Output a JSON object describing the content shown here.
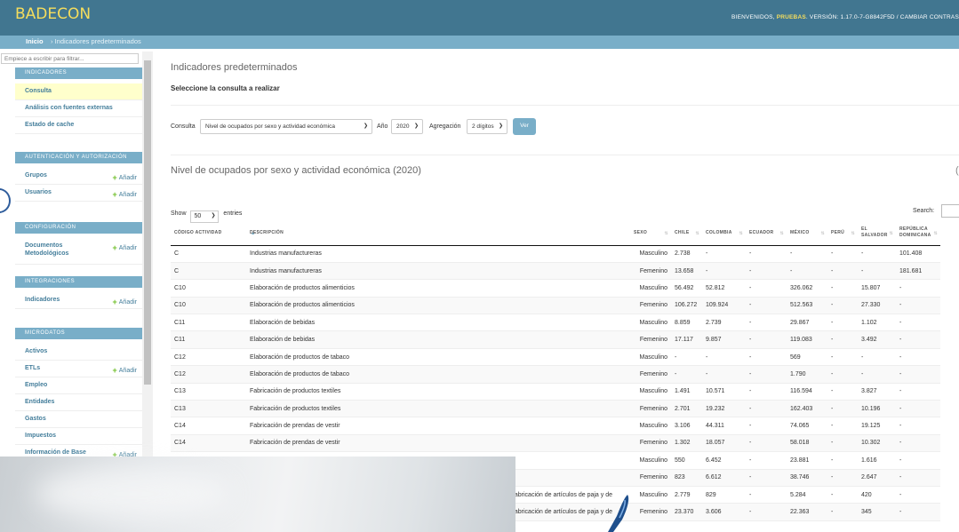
{
  "header": {
    "brand": "BADECON",
    "welcome": "BIENVENIDOS,",
    "user": "PRUEBAS",
    "tools": ". VERSIÓN: 1.17.0-7-G8842F5D / CAMBIAR CONTRAS"
  },
  "breadcrumbs": {
    "home": "Inicio",
    "sep": "›",
    "current": "Indicadores predeterminados"
  },
  "sidebar": {
    "filter_placeholder": "Empiece a escribir para filtrar...",
    "add_label": "Añadir",
    "modules": [
      {
        "header": "INDICADORES",
        "items": [
          {
            "label": "Consulta",
            "add": false,
            "active": true
          },
          {
            "label": "Análisis con fuentes externas",
            "add": false
          },
          {
            "label": "Estado de cache",
            "add": false
          }
        ]
      },
      {
        "header": "AUTENTICACIÓN Y AUTORIZACIÓN",
        "items": [
          {
            "label": "Grupos",
            "add": true
          },
          {
            "label": "Usuarios",
            "add": true
          }
        ]
      },
      {
        "header": "CONFIGURACIÓN",
        "items": [
          {
            "label": "Documentos Metodológicos",
            "add": true
          }
        ]
      },
      {
        "header": "INTEGRACIONES",
        "items": [
          {
            "label": "Indicadores",
            "add": true
          }
        ]
      },
      {
        "header": "MICRODATOS",
        "items": [
          {
            "label": "Activos",
            "add": false
          },
          {
            "label": "ETLs",
            "add": true
          },
          {
            "label": "Empleo",
            "add": false
          },
          {
            "label": "Entidades",
            "add": false
          },
          {
            "label": "Gastos",
            "add": false
          },
          {
            "label": "Impuestos",
            "add": false
          },
          {
            "label": "Información de Base",
            "add": true
          }
        ]
      }
    ]
  },
  "main": {
    "title": "Indicadores predeterminados",
    "subtitle": "Seleccione la consulta a realizar",
    "form": {
      "consulta_label": "Consulta",
      "consulta_value": "Nivel de ocupados por sexo y actividad económica",
      "anio_label": "Año",
      "anio_value": "2020",
      "agregacion_label": "Agregación",
      "agregacion_value": "2 dígitos",
      "submit": "Ver"
    },
    "table_title": "Nivel de ocupados por sexo y actividad económica (2020)",
    "right_fragment": "(",
    "show_label": "Show",
    "show_value": "50",
    "entries_label": "entries",
    "search_label": "Search:"
  },
  "table": {
    "columns": [
      "CÓDIGO ACTIVIDAD",
      "DESCRIPCIÓN",
      "SEXO",
      "CHILE",
      "COLOMBIA",
      "ECUADOR",
      "MÉXICO",
      "PERÚ",
      "EL SALVADOR",
      "REPÚBLICA DOMINICANA"
    ],
    "rows": [
      [
        "C",
        "Industrias manufactureras",
        "Masculino",
        "2.738",
        "-",
        "-",
        "-",
        "-",
        "-",
        "101.408"
      ],
      [
        "C",
        "Industrias manufactureras",
        "Femenino",
        "13.658",
        "-",
        "-",
        "-",
        "-",
        "-",
        "181.681"
      ],
      [
        "C10",
        "Elaboración de productos alimenticios",
        "Masculino",
        "56.492",
        "52.812",
        "-",
        "326.062",
        "-",
        "15.807",
        "-"
      ],
      [
        "C10",
        "Elaboración de productos alimenticios",
        "Femenino",
        "106.272",
        "109.924",
        "-",
        "512.563",
        "-",
        "27.330",
        "-"
      ],
      [
        "C11",
        "Elaboración de bebidas",
        "Masculino",
        "8.859",
        "2.739",
        "-",
        "29.867",
        "-",
        "1.102",
        "-"
      ],
      [
        "C11",
        "Elaboración de bebidas",
        "Femenino",
        "17.117",
        "9.857",
        "-",
        "119.083",
        "-",
        "3.492",
        "-"
      ],
      [
        "C12",
        "Elaboración de productos de tabaco",
        "Masculino",
        "-",
        "-",
        "-",
        "569",
        "-",
        "-",
        "-"
      ],
      [
        "C12",
        "Elaboración de productos de tabaco",
        "Femenino",
        "-",
        "-",
        "-",
        "1.790",
        "-",
        "-",
        "-"
      ],
      [
        "C13",
        "Fabricación de productos textiles",
        "Masculino",
        "1.491",
        "10.571",
        "-",
        "116.594",
        "-",
        "3.827",
        "-"
      ],
      [
        "C13",
        "Fabricación de productos textiles",
        "Femenino",
        "2.701",
        "19.232",
        "-",
        "162.403",
        "-",
        "10.196",
        "-"
      ],
      [
        "C14",
        "Fabricación de prendas de vestir",
        "Masculino",
        "3.106",
        "44.311",
        "-",
        "74.065",
        "-",
        "19.125",
        "-"
      ],
      [
        "C14",
        "Fabricación de prendas de vestir",
        "Femenino",
        "1.302",
        "18.057",
        "-",
        "58.018",
        "-",
        "10.302",
        "-"
      ],
      [
        "",
        "",
        "Masculino",
        "550",
        "6.452",
        "-",
        "23.881",
        "-",
        "1.616",
        "-"
      ],
      [
        "",
        "",
        "Femenino",
        "823",
        "6.612",
        "-",
        "38.746",
        "-",
        "2.647",
        "-"
      ],
      [
        "",
        "abricación de artículos de paja y de",
        "Masculino",
        "2.779",
        "829",
        "-",
        "5.284",
        "-",
        "420",
        "-"
      ],
      [
        "",
        "abricación de artículos de paja y de",
        "Femenino",
        "23.370",
        "3.606",
        "-",
        "22.363",
        "-",
        "345",
        "-"
      ]
    ]
  }
}
